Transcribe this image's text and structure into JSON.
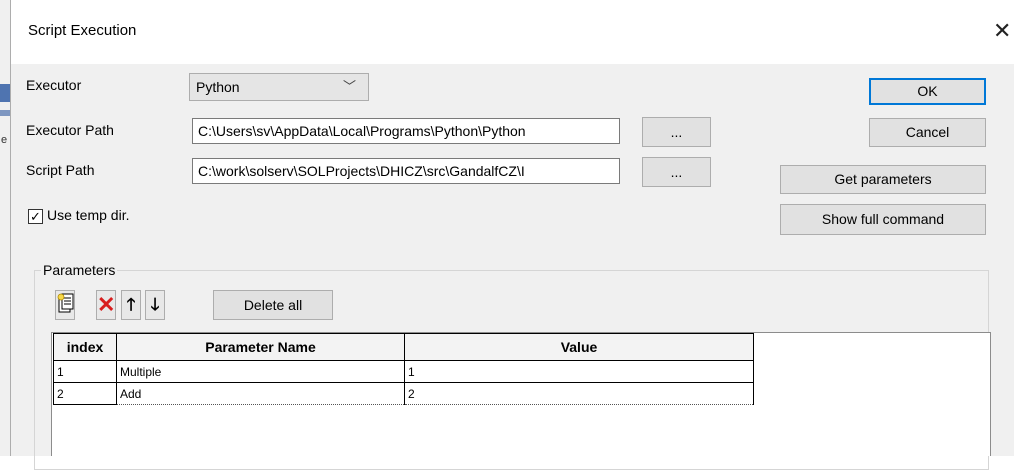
{
  "background_fragment": "e",
  "window": {
    "title": "Script Execution",
    "close_glyph": "✕"
  },
  "fields": {
    "executor_label": "Executor",
    "executor_value": "Python",
    "executor_path_label": "Executor Path",
    "executor_path_value": "C:\\Users\\sv\\AppData\\Local\\Programs\\Python\\Python",
    "script_path_label": "Script Path",
    "script_path_value": "C:\\work\\solserv\\SOLProjects\\DHICZ\\src\\GandalfCZ\\I",
    "browse_label": "...",
    "use_temp_dir_label": "Use temp dir.",
    "use_temp_dir_checked": true
  },
  "buttons": {
    "ok": "OK",
    "cancel": "Cancel",
    "get_parameters": "Get parameters",
    "show_full_command": "Show full command",
    "delete_all": "Delete all"
  },
  "parameters": {
    "group_label": "Parameters",
    "toolbar_icons": [
      "new-parameter-icon",
      "delete-icon",
      "move-up-icon",
      "move-down-icon"
    ],
    "columns": [
      "index",
      "Parameter Name",
      "Value"
    ],
    "rows": [
      {
        "index": "1",
        "name": "Multiple",
        "value": "1"
      },
      {
        "index": "2",
        "name": "Add",
        "value": "2"
      }
    ]
  },
  "colors": {
    "dialog_bg": "#f0f0f0",
    "default_button_border": "#0078d7",
    "delete_icon": "#d81e1e"
  }
}
